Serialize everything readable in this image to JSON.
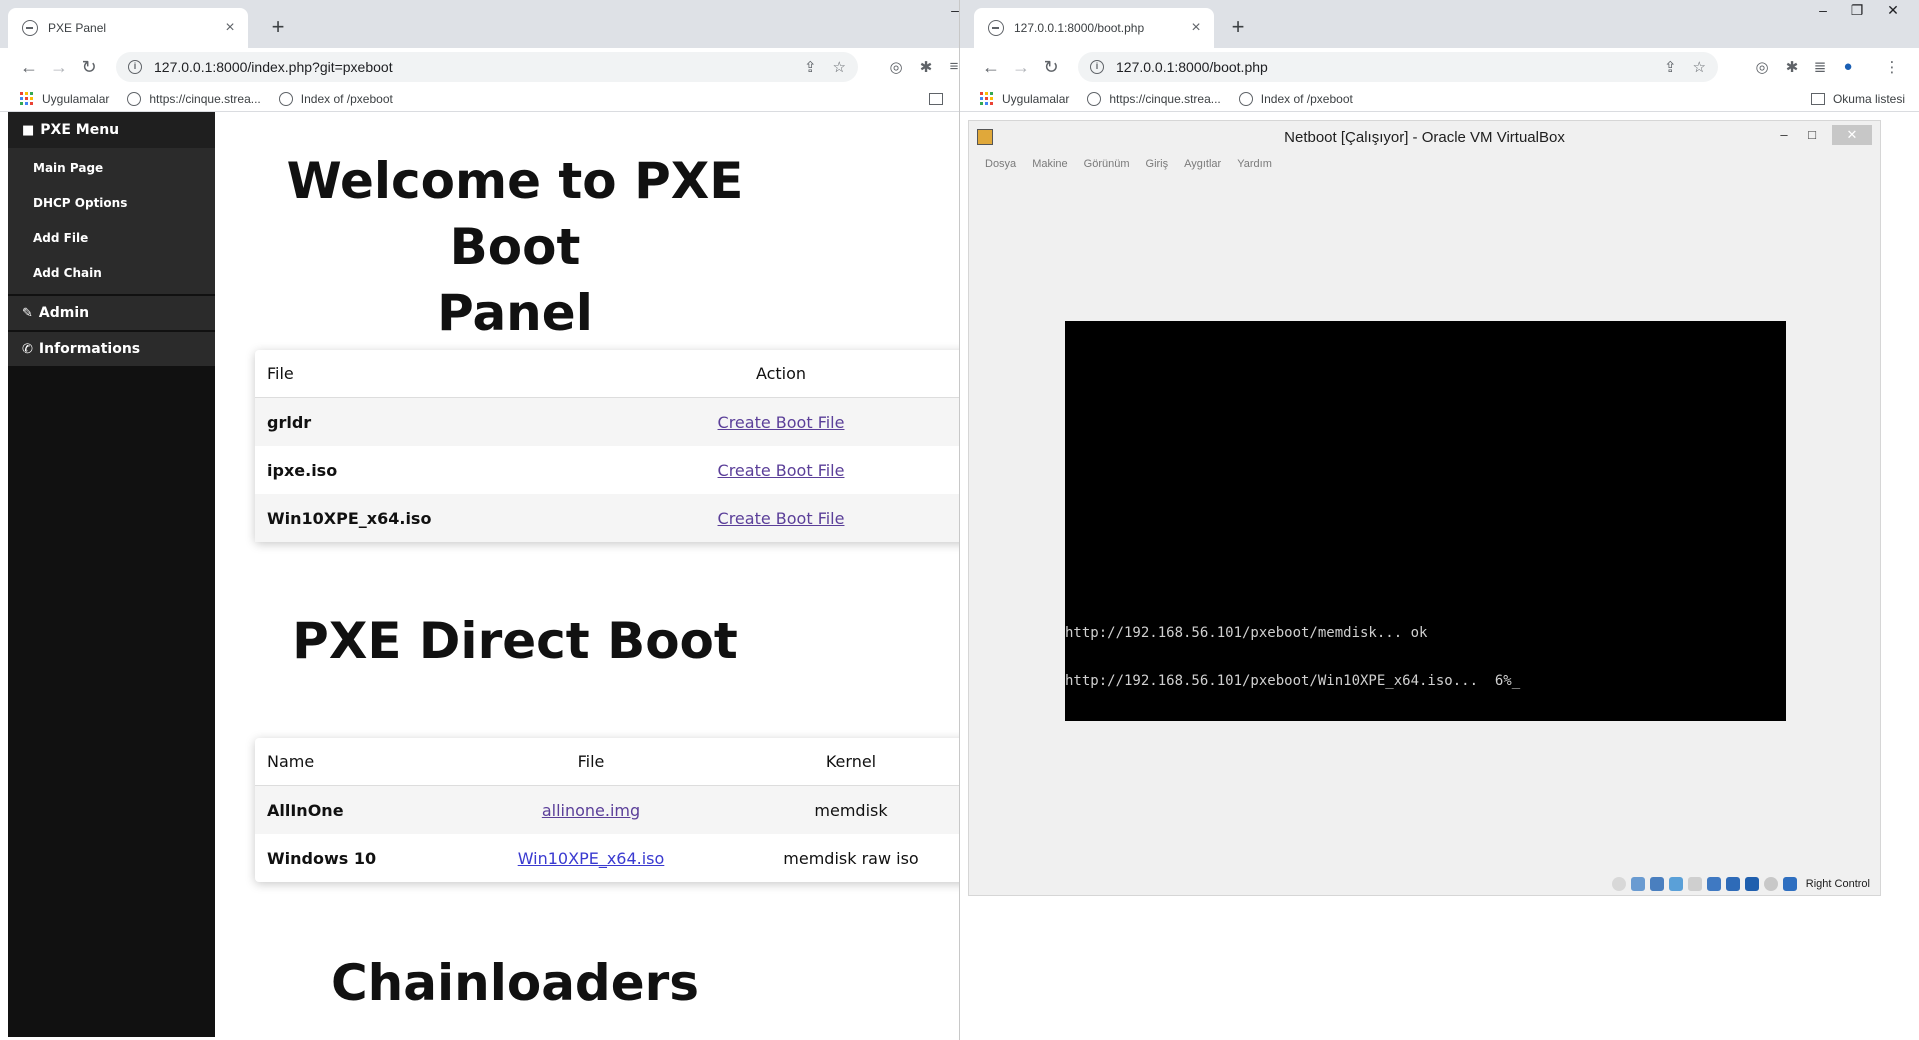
{
  "left_window": {
    "tab_title": "PXE Panel",
    "url": "127.0.0.1:8000/index.php?git=pxeboot",
    "bookmarks": [
      "Uygulamalar",
      "https://cinque.strea...",
      "Index of /pxeboot"
    ],
    "sidebar": {
      "menu_title": "PXE Menu",
      "items": [
        "Main Page",
        "DHCP Options",
        "Add File",
        "Add Chain"
      ],
      "sections": [
        "Admin",
        "Informations"
      ]
    },
    "welcome_title_line1": "Welcome to PXE Boot",
    "welcome_title_line2": "Panel",
    "files_table": {
      "headers": [
        "File",
        "Action"
      ],
      "rows": [
        {
          "file": "grldr",
          "action": "Create Boot File"
        },
        {
          "file": "ipxe.iso",
          "action": "Create Boot File"
        },
        {
          "file": "Win10XPE_x64.iso",
          "action": "Create Boot File"
        }
      ]
    },
    "direct_title": "PXE Direct Boot",
    "direct_table": {
      "headers": [
        "Name",
        "File",
        "Kernel"
      ],
      "rows": [
        {
          "name": "AllInOne",
          "file": "allinone.img",
          "kernel": "memdisk"
        },
        {
          "name": "Windows 10",
          "file": "Win10XPE_x64.iso",
          "kernel": "memdisk raw iso"
        }
      ]
    },
    "chain_title": "Chainloaders"
  },
  "right_window": {
    "tab_title": "127.0.0.1:8000/boot.php",
    "url": "127.0.0.1:8000/boot.php",
    "bookmarks": [
      "Uygulamalar",
      "https://cinque.strea...",
      "Index of /pxeboot"
    ],
    "reading_list": "Okuma listesi",
    "vbox": {
      "title": "Netboot [Çalışıyor] - Oracle VM VirtualBox",
      "menu": [
        "Dosya",
        "Makine",
        "Görünüm",
        "Giriş",
        "Aygıtlar",
        "Yardım"
      ],
      "console_line1": "http://192.168.56.101/pxeboot/memdisk... ok",
      "console_line2": "http://192.168.56.101/pxeboot/Win10XPE_x64.iso...  6%_",
      "host_key": "Right Control"
    }
  },
  "colors": {
    "sidebar_bg": "#111111",
    "link_visited": "#5b3f99",
    "link": "#3a3ad0",
    "tabstrip": "#dee1e6"
  }
}
